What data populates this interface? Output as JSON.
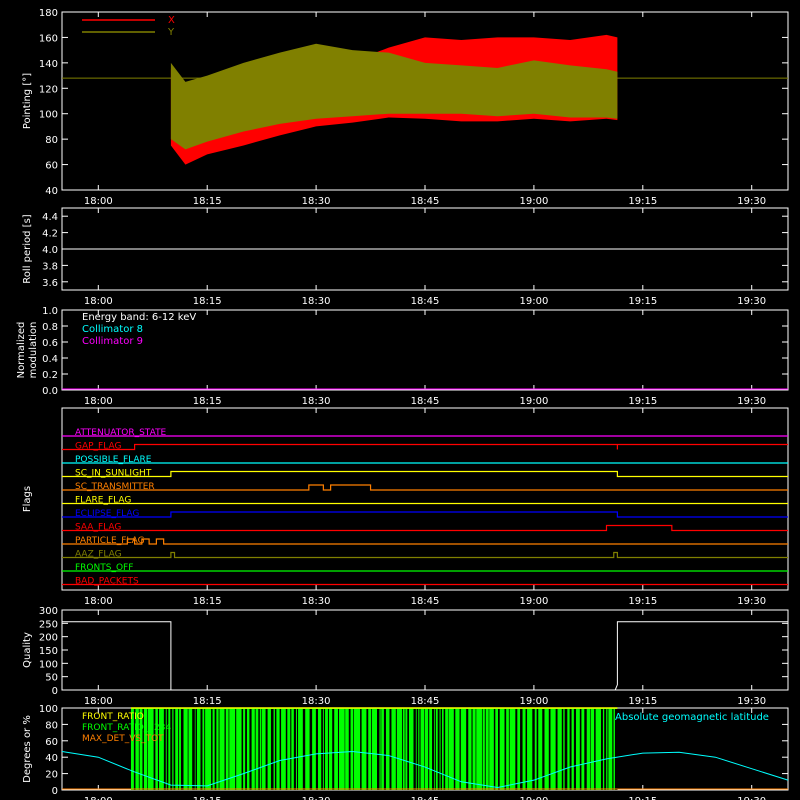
{
  "chart_data": [
    {
      "type": "area",
      "ylabel": "Pointing [°]",
      "ylim": [
        40,
        180
      ],
      "yticks": [
        40,
        60,
        80,
        100,
        120,
        140,
        160,
        180
      ],
      "xticks": [
        "18:00",
        "18:15",
        "18:30",
        "18:45",
        "19:00",
        "19:15",
        "19:30"
      ],
      "xlim_minutes": [
        -5,
        95
      ],
      "series": [
        {
          "name": "X",
          "color": "#ff0000",
          "x": [
            10,
            12,
            15,
            20,
            25,
            30,
            35,
            40,
            45,
            50,
            55,
            60,
            65,
            70,
            71.5
          ],
          "upper": [
            135,
            120,
            128,
            132,
            133,
            136,
            141,
            152,
            160,
            158,
            160,
            160,
            158,
            162,
            160
          ],
          "lower": [
            75,
            60,
            68,
            75,
            83,
            90,
            93,
            97,
            96,
            94,
            94,
            96,
            94,
            96,
            95
          ]
        },
        {
          "name": "Y",
          "color": "#808000",
          "x": [
            10,
            12,
            15,
            20,
            25,
            30,
            35,
            40,
            45,
            50,
            55,
            60,
            65,
            70,
            71.5
          ],
          "upper": [
            140,
            125,
            130,
            140,
            148,
            155,
            150,
            148,
            140,
            138,
            136,
            142,
            138,
            135,
            133
          ],
          "lower": [
            80,
            72,
            78,
            86,
            92,
            96,
            98,
            100,
            100,
            100,
            98,
            100,
            97,
            97,
            96
          ]
        }
      ],
      "baseline": 128
    },
    {
      "type": "line",
      "ylabel": "Roll period [s]",
      "ylim": [
        3.5,
        4.5
      ],
      "yticks": [
        3.6,
        3.8,
        4.0,
        4.2,
        4.4
      ],
      "xticks": [
        "18:00",
        "18:15",
        "18:30",
        "18:45",
        "19:00",
        "19:15",
        "19:30"
      ],
      "series": [
        {
          "name": "",
          "color": "#ffffff",
          "x": [
            -5,
            95
          ],
          "y": [
            4.0,
            4.0
          ]
        }
      ]
    },
    {
      "type": "line",
      "ylabel": "Normalized modulation",
      "ylim": [
        0,
        1
      ],
      "yticks": [
        0.0,
        0.2,
        0.4,
        0.6,
        0.8,
        1.0
      ],
      "xticks": [
        "18:00",
        "18:15",
        "18:30",
        "18:45",
        "19:00",
        "19:15",
        "19:30"
      ],
      "annotation": "Energy band: 6-12 keV",
      "series": [
        {
          "name": "Collimator 8",
          "color": "#00ffff",
          "x": [
            -5,
            95
          ],
          "y": [
            0,
            0
          ]
        },
        {
          "name": "Collimator 9",
          "color": "#ff00ff",
          "x": [
            -5,
            95
          ],
          "y": [
            0,
            0
          ]
        }
      ]
    },
    {
      "type": "line",
      "ylabel": "Flags",
      "xticks": [
        "18:00",
        "18:15",
        "18:30",
        "18:45",
        "19:00",
        "19:15",
        "19:30"
      ],
      "flags": [
        {
          "name": "ATTENUATOR_STATE",
          "color": "#ff00ff",
          "steps": []
        },
        {
          "name": "SAA_FLAG_GAP",
          "label": "GAP_FLAG",
          "color": "#ff0000",
          "steps": [
            [
              5,
              1
            ],
            [
              71.5,
              0
            ],
            [
              71.5,
              1
            ]
          ]
        },
        {
          "name": "POSSIBLE_FLARE",
          "color": "#00ffff",
          "steps": []
        },
        {
          "name": "SC_IN_SUNLIGHT",
          "color": "#ffff00",
          "steps": [
            [
              10,
              1
            ],
            [
              71.5,
              0
            ]
          ]
        },
        {
          "name": "SC_TRANSMITTER",
          "color": "#ff8000",
          "steps": [
            [
              29,
              1
            ],
            [
              31,
              0
            ],
            [
              32,
              1
            ],
            [
              37.5,
              0
            ]
          ]
        },
        {
          "name": "FLARE_FLAG",
          "color": "#ffff00",
          "steps": []
        },
        {
          "name": "ECLIPSE_FLAG",
          "color": "#0000ff",
          "steps": [
            [
              10,
              1
            ],
            [
              71.5,
              0
            ]
          ]
        },
        {
          "name": "SAA_FLAG",
          "color": "#ff0000",
          "steps": [
            [
              70,
              1
            ],
            [
              79,
              0
            ]
          ]
        },
        {
          "name": "PARTICLE_FLAG",
          "color": "#ff8000",
          "steps": [
            [
              4,
              1
            ],
            [
              5,
              0
            ],
            [
              6,
              1
            ],
            [
              7,
              0
            ],
            [
              8,
              1
            ],
            [
              9,
              0
            ]
          ]
        },
        {
          "name": "AAZ_FLAG",
          "color": "#808000",
          "steps": [
            [
              10,
              1
            ],
            [
              10.5,
              0
            ],
            [
              71,
              1
            ],
            [
              71.5,
              0
            ]
          ]
        },
        {
          "name": "FRONTS_OFF",
          "color": "#00ff00",
          "steps": []
        },
        {
          "name": "BAD_PACKETS",
          "color": "#ff0000",
          "steps": []
        }
      ]
    },
    {
      "type": "line",
      "ylabel": "Quality",
      "ylim": [
        0,
        300
      ],
      "yticks": [
        0,
        50,
        100,
        150,
        200,
        250,
        300
      ],
      "xticks": [
        "18:00",
        "18:15",
        "18:30",
        "18:45",
        "19:00",
        "19:15",
        "19:30"
      ],
      "series": [
        {
          "name": "",
          "color": "#ffffff",
          "x": [
            -5,
            10,
            10,
            71.2,
            71.5,
            71.5,
            95
          ],
          "y": [
            256,
            256,
            0,
            0,
            20,
            256,
            256
          ]
        }
      ]
    },
    {
      "type": "area",
      "ylabel": "Degrees or %",
      "ylim": [
        0,
        100
      ],
      "yticks": [
        0,
        20,
        40,
        60,
        80,
        100
      ],
      "xticks": [
        "18:00",
        "18:15",
        "18:30",
        "18:45",
        "19:00",
        "19:15",
        "19:30"
      ],
      "legend": [
        {
          "name": "FRONT_RATIO",
          "color": "#ffff00"
        },
        {
          "name": "FRONT_RATIO_1234",
          "color": "#00ff00"
        },
        {
          "name": "MAX_DET_VS_TOT",
          "color": "#ff8000"
        }
      ],
      "annotation": "Absolute geomagnetic latitude",
      "annotation_color": "#00ffff",
      "green_band": [
        4.5,
        71.5
      ],
      "latitude": {
        "color": "#00ffff",
        "x": [
          -5,
          0,
          5,
          10,
          15,
          20,
          25,
          30,
          35,
          40,
          45,
          50,
          55,
          60,
          65,
          70,
          75,
          80,
          85,
          90,
          95
        ],
        "y": [
          47,
          40,
          22,
          6,
          5,
          20,
          36,
          44,
          47,
          42,
          28,
          10,
          3,
          12,
          28,
          38,
          45,
          46,
          40,
          26,
          12
        ]
      }
    }
  ]
}
